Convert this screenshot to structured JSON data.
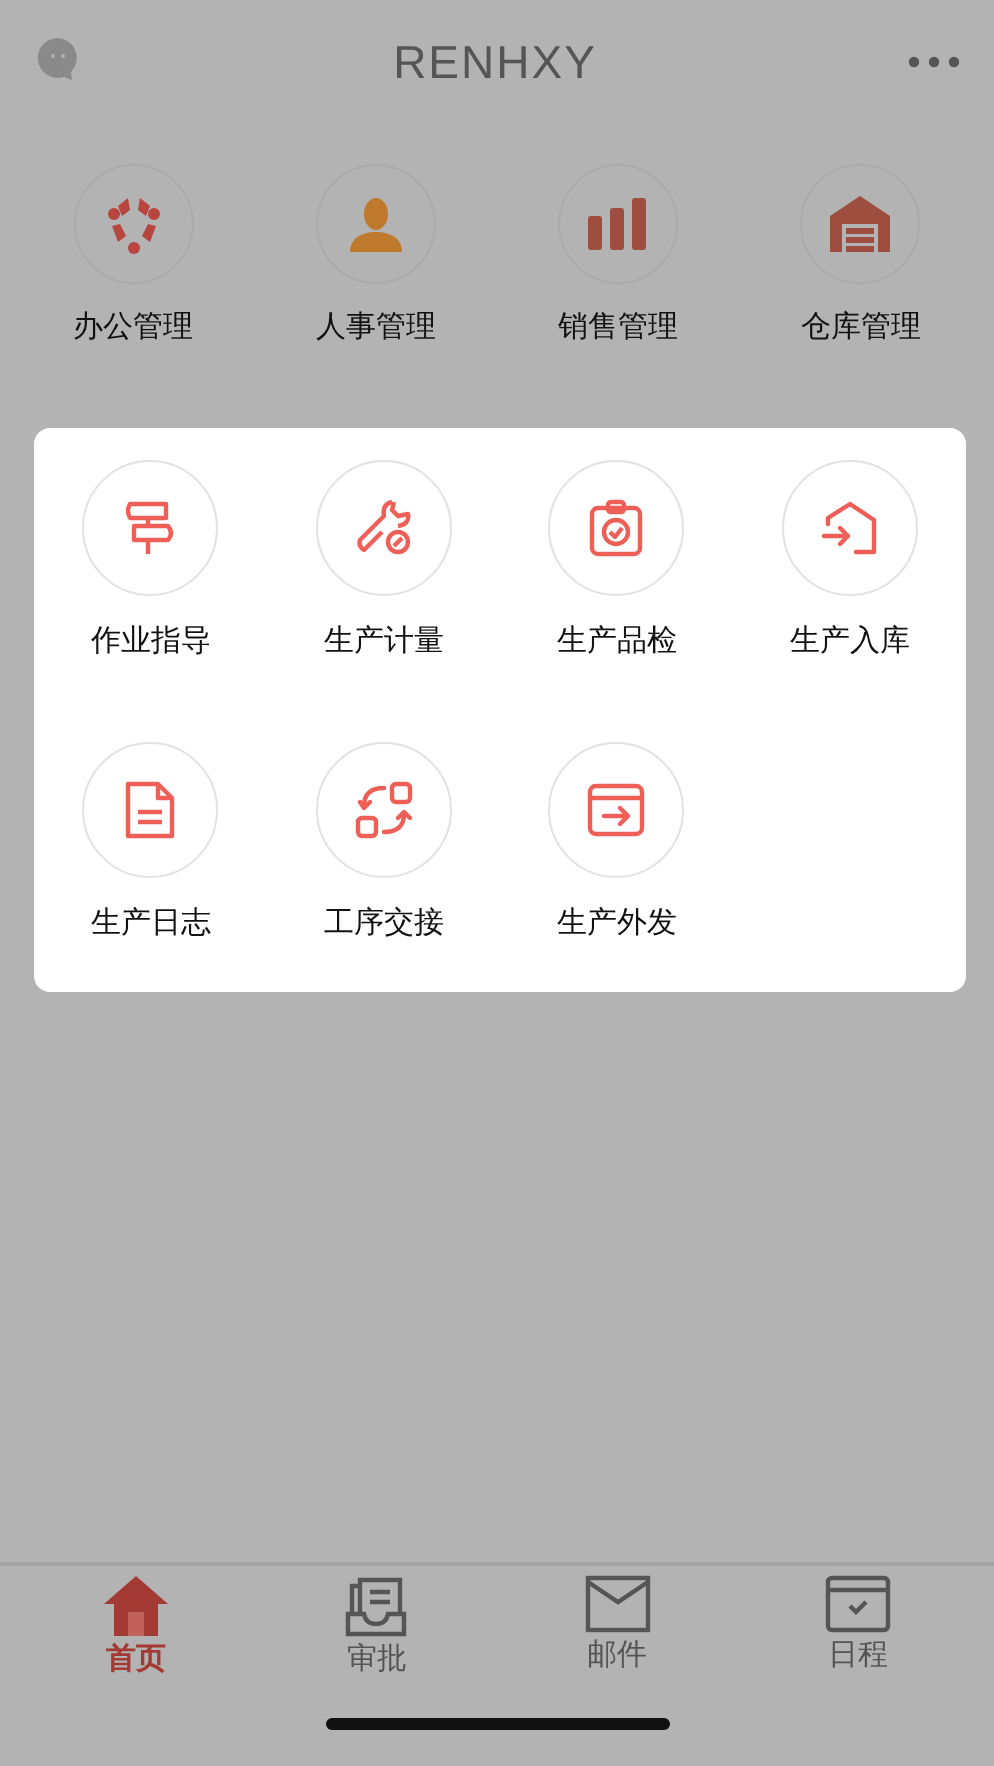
{
  "header": {
    "title": "RENHXY"
  },
  "modules": [
    {
      "label": "办公管理"
    },
    {
      "label": "人事管理"
    },
    {
      "label": "销售管理"
    },
    {
      "label": "仓库管理"
    }
  ],
  "popup": {
    "items": [
      {
        "label": "作业指导"
      },
      {
        "label": "生产计量"
      },
      {
        "label": "生产品检"
      },
      {
        "label": "生产入库"
      },
      {
        "label": "生产日志"
      },
      {
        "label": "工序交接"
      },
      {
        "label": "生产外发"
      }
    ]
  },
  "tabs": [
    {
      "label": "首页",
      "selected": true
    },
    {
      "label": "审批",
      "selected": false
    },
    {
      "label": "邮件",
      "selected": false
    },
    {
      "label": "日程",
      "selected": false
    }
  ]
}
